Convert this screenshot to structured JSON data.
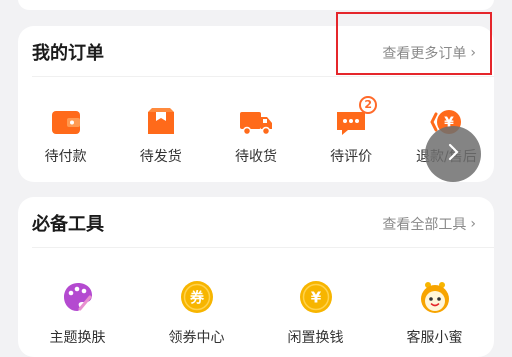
{
  "orders": {
    "title": "我的订单",
    "more_label": "查看更多订单",
    "items": [
      {
        "label": "待付款",
        "icon": "wallet-icon"
      },
      {
        "label": "待发货",
        "icon": "package-icon"
      },
      {
        "label": "待收货",
        "icon": "truck-icon"
      },
      {
        "label": "待评价",
        "icon": "comment-icon",
        "badge": "2"
      },
      {
        "label": "退款/售后",
        "icon": "refund-icon"
      }
    ]
  },
  "tools": {
    "title": "必备工具",
    "more_label": "查看全部工具",
    "items": [
      {
        "label": "主题换肤",
        "icon": "palette-icon"
      },
      {
        "label": "领券中心",
        "icon": "coupon-icon",
        "icon_text": "券"
      },
      {
        "label": "闲置换钱",
        "icon": "yuan-coin-icon",
        "icon_text": "¥"
      },
      {
        "label": "客服小蜜",
        "icon": "service-bee-icon"
      }
    ]
  },
  "refund_icon_text": "¥",
  "colors": {
    "accent": "#ff6a1a",
    "highlight": "#e5262b",
    "coin": "#f7b500"
  }
}
